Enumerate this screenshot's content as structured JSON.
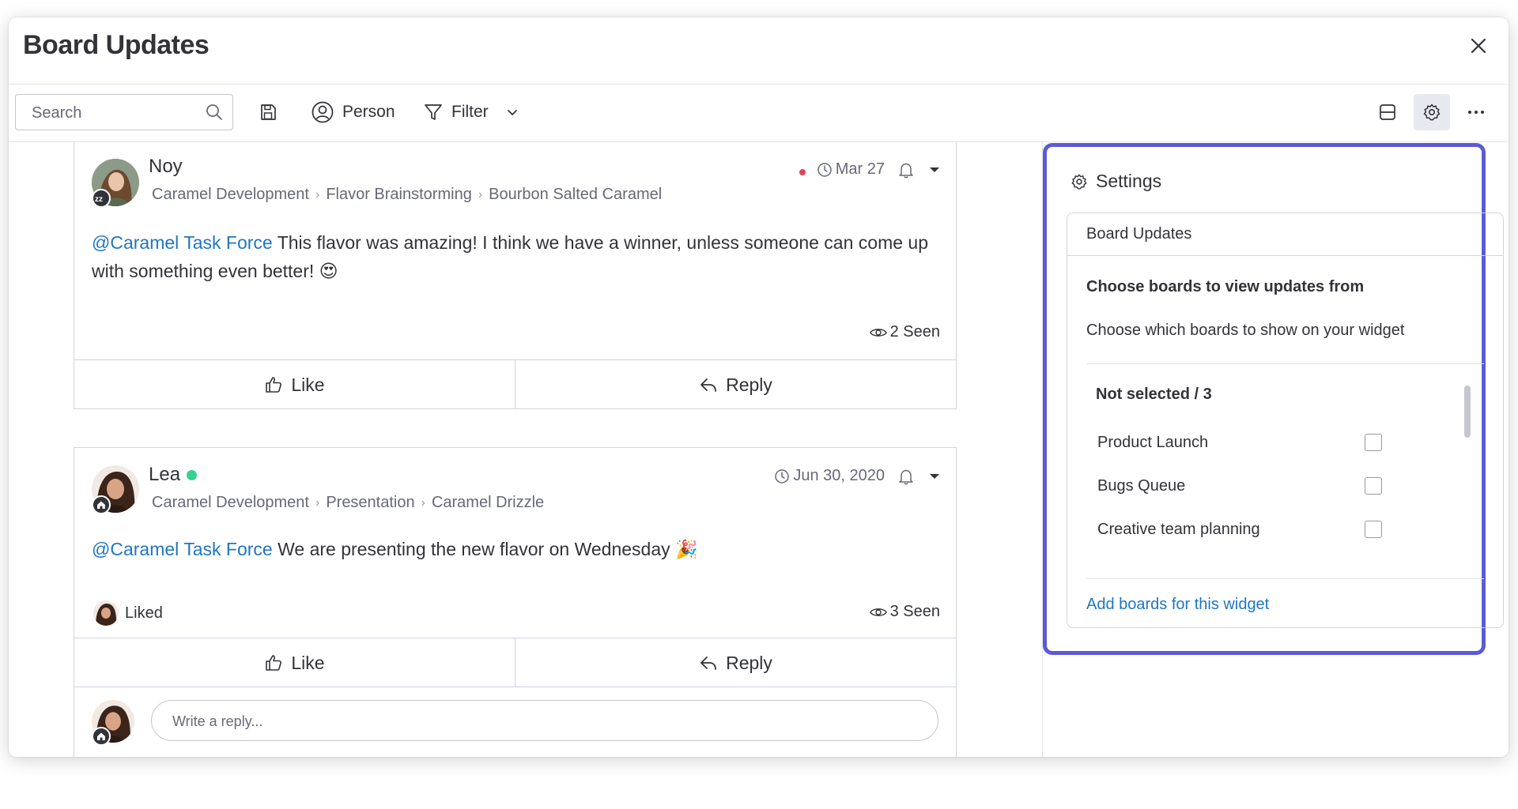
{
  "window": {
    "title": "Board Updates"
  },
  "toolbar": {
    "search_placeholder": "Search",
    "person_label": "Person",
    "filter_label": "Filter"
  },
  "updates": [
    {
      "author": "Noy",
      "breadcrumb": [
        "Caramel Development",
        "Flavor Brainstorming",
        "Bourbon Salted Caramel"
      ],
      "date": "Mar 27",
      "mention": "@Caramel Task Force",
      "text": " This flavor was amazing! I think we have a winner, unless someone can come up with something even better! 😍",
      "seen": "2 Seen",
      "like_label": "Like",
      "reply_label": "Reply"
    },
    {
      "author": "Lea",
      "breadcrumb": [
        "Caramel Development",
        "Presentation",
        "Caramel Drizzle"
      ],
      "date": "Jun 30, 2020",
      "mention": "@Caramel Task Force",
      "text": " We are presenting the new flavor on Wednesday 🎉",
      "liked_label": "Liked",
      "seen": "3 Seen",
      "like_label": "Like",
      "reply_label": "Reply",
      "reply_placeholder": "Write a reply..."
    }
  ],
  "settings": {
    "title": "Settings",
    "card_title": "Board Updates",
    "choose_title": "Choose boards to view updates from",
    "choose_sub": "Choose which boards to show on your widget",
    "not_selected": "Not selected / 3",
    "boards": [
      "Product Launch",
      "Bugs Queue",
      "Creative team planning"
    ],
    "add_boards": "Add boards for this widget"
  },
  "colors": {
    "accent": "#5b5bd6",
    "link": "#1f76c2",
    "online": "#33d391",
    "unread_dot": "#e2445c"
  }
}
